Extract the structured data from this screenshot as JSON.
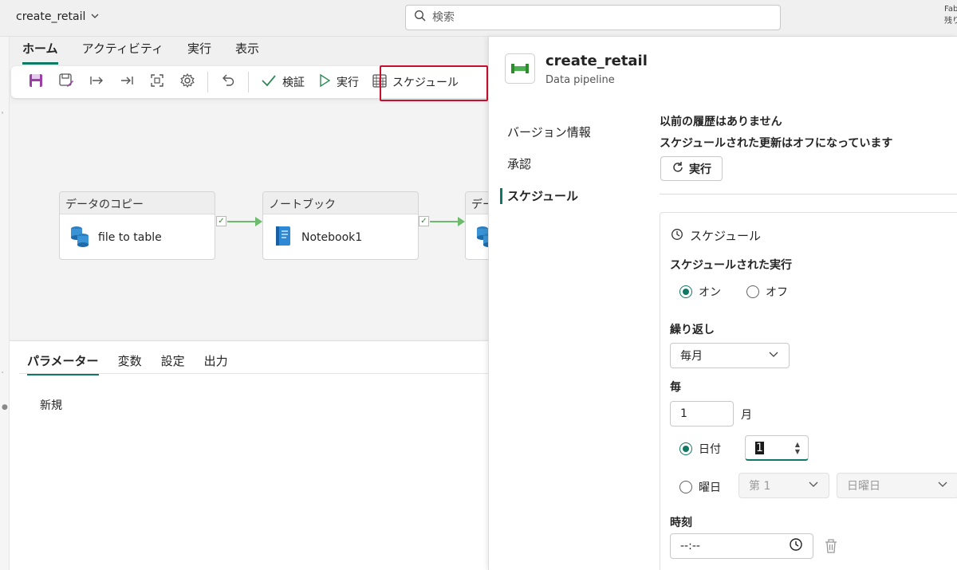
{
  "app": {
    "workspace_name": "create_retail",
    "search_placeholder": "検索",
    "corner_text_line1": "Fab",
    "corner_text_line2": "残り"
  },
  "menu": {
    "tabs": [
      {
        "label": "ホーム",
        "active": true
      },
      {
        "label": "アクティビティ"
      },
      {
        "label": "実行"
      },
      {
        "label": "表示"
      }
    ]
  },
  "toolbar": {
    "icons": [
      "save-icon",
      "save-as-icon",
      "move-right-icon",
      "move-end-icon",
      "scan-icon",
      "gear-icon",
      "undo-icon"
    ],
    "validate_label": "検証",
    "run_label": "実行",
    "schedule_label": "スケジュール"
  },
  "canvas": {
    "activities": [
      {
        "header": "データのコピー",
        "name": "file to table",
        "icon": "copy-data-icon"
      },
      {
        "header": "ノートブック",
        "name": "Notebook1",
        "icon": "notebook-icon"
      },
      {
        "header": "デー",
        "name": "",
        "icon": "copy-data-icon"
      }
    ],
    "accent_color": "#6dbb6d"
  },
  "bottom": {
    "tabs": [
      {
        "label": "パラメーター",
        "active": true
      },
      {
        "label": "変数"
      },
      {
        "label": "設定"
      },
      {
        "label": "出力"
      }
    ],
    "new_label": "新規"
  },
  "panel": {
    "title": "create_retail",
    "subtitle": "Data pipeline",
    "nav": [
      {
        "label": "バージョン情報"
      },
      {
        "label": "承認"
      },
      {
        "label": "スケジュール",
        "active": true
      }
    ],
    "no_history": "以前の履歴はありません",
    "schedule_off": "スケジュールされた更新はオフになっています",
    "run_button": "実行",
    "schedule": {
      "header": "スケジュール",
      "scheduled_run_label": "スケジュールされた実行",
      "on_label": "オン",
      "off_label": "オフ",
      "scheduled_run_value": "オン",
      "repeat_label": "繰り返し",
      "repeat_value": "毎月",
      "every_label": "毎",
      "every_value": "1",
      "every_unit": "月",
      "date_label": "日付",
      "date_value": "1",
      "weekday_label": "曜日",
      "week_ordinal_value": "第 1",
      "weekday_value": "日曜日",
      "time_label": "時刻",
      "time_value": "--:--"
    },
    "accent_color": "#117865"
  },
  "highlight_color": "#c8102e"
}
